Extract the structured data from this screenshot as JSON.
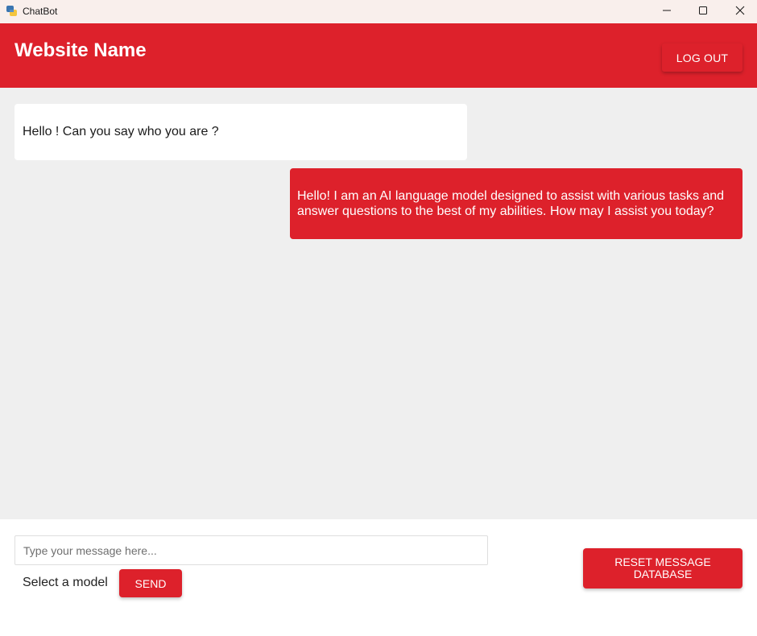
{
  "window": {
    "title": "ChatBot",
    "icons": {
      "app": "python-icon",
      "minimize": "minimize-icon",
      "maximize": "maximize-icon",
      "close": "close-icon"
    }
  },
  "header": {
    "site_name": "Website Name",
    "logout_label": "LOG OUT"
  },
  "chat": {
    "messages": [
      {
        "role": "user",
        "text": "Hello ! Can you say who you are ?"
      },
      {
        "role": "bot",
        "text": "Hello! I am an AI language model designed to assist with various tasks and answer questions to the best of my abilities. How may I assist you today?"
      }
    ]
  },
  "composer": {
    "placeholder": "Type your message here...",
    "value": "",
    "model_label": "Select a model",
    "send_label": "SEND",
    "reset_label": "RESET MESSAGE DATABASE"
  },
  "colors": {
    "accent": "#dd212b",
    "chat_bg": "#efefef",
    "titlebar_bg": "#f9efec"
  }
}
